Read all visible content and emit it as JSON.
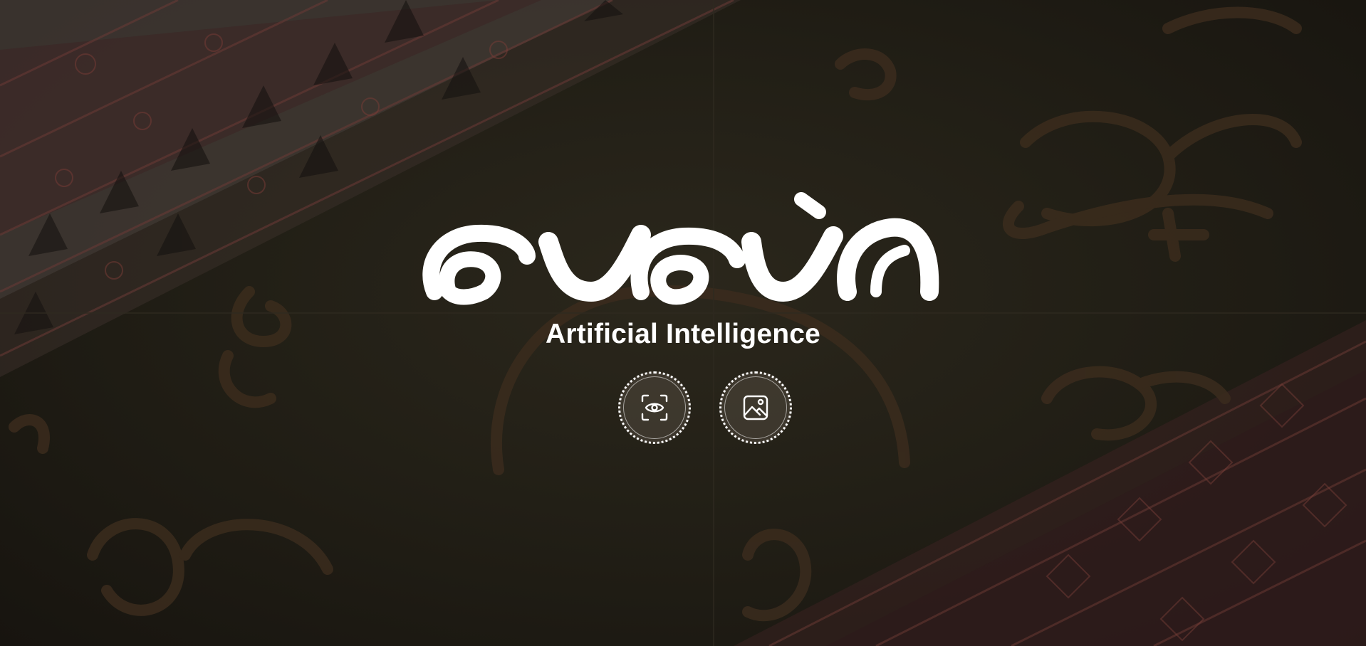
{
  "hero": {
    "logo_icon": "baybayin-script-logo",
    "subtitle": "Artificial Intelligence"
  },
  "actions": [
    {
      "name": "scan-eye-button",
      "icon": "scan-eye-icon"
    },
    {
      "name": "image-upload-button",
      "icon": "image-icon"
    }
  ],
  "colors": {
    "background": "#1f1c15",
    "text": "#ffffff",
    "script_watermark": "#3a2d1f",
    "textile_red": "#4a2224"
  }
}
